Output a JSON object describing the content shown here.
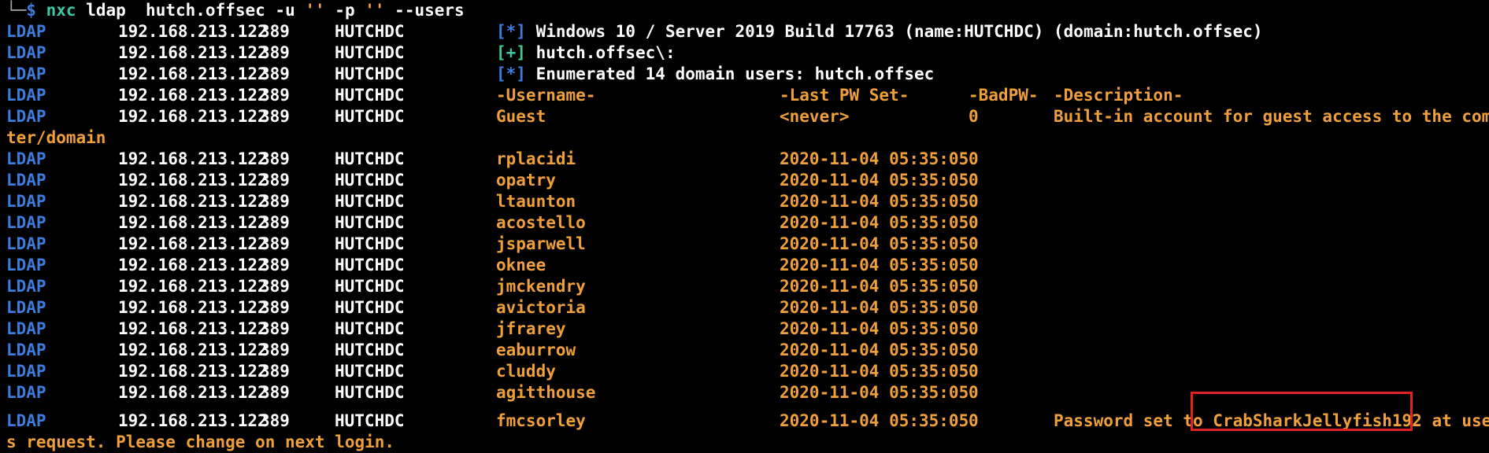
{
  "prompt": {
    "tree": "└─",
    "dollar": "$",
    "cmd": "nxc",
    "args_a": "ldap  hutch.offsec ",
    "flag_u": "-u",
    "val_u": " '' ",
    "flag_p": "-p",
    "val_p": " '' ",
    "flag_users": "--users"
  },
  "info_lines": [
    {
      "proto": "LDAP",
      "ip": "192.168.213.122",
      "port": "389",
      "host": "HUTCHDC",
      "tag": "[*]",
      "text": " Windows 10 / Server 2019 Build 17763 (name:HUTCHDC) (domain:hutch.offsec)"
    },
    {
      "proto": "LDAP",
      "ip": "192.168.213.122",
      "port": "389",
      "host": "HUTCHDC",
      "tag": "[+]",
      "text": " hutch.offsec\\:"
    },
    {
      "proto": "LDAP",
      "ip": "192.168.213.122",
      "port": "389",
      "host": "HUTCHDC",
      "tag": "[*]",
      "text": " Enumerated 14 domain users: hutch.offsec"
    }
  ],
  "header": {
    "proto": "LDAP",
    "ip": "192.168.213.122",
    "port": "389",
    "host": "HUTCHDC",
    "username": "-Username-",
    "pwset": "-Last PW Set-",
    "badpw": "-BadPW-",
    "description": "-Description-"
  },
  "guest": {
    "proto": "LDAP",
    "ip": "192.168.213.122",
    "port": "389",
    "host": "HUTCHDC",
    "username": "Guest",
    "pwset": "<never>",
    "badpw": "0",
    "description": "Built-in account for guest access to the compu",
    "wrap": "ter/domain"
  },
  "users": [
    {
      "proto": "LDAP",
      "ip": "192.168.213.122",
      "port": "389",
      "host": "HUTCHDC",
      "username": "rplacidi",
      "pwset": "2020-11-04 05:35:05",
      "badpw": "0"
    },
    {
      "proto": "LDAP",
      "ip": "192.168.213.122",
      "port": "389",
      "host": "HUTCHDC",
      "username": "opatry",
      "pwset": "2020-11-04 05:35:05",
      "badpw": "0"
    },
    {
      "proto": "LDAP",
      "ip": "192.168.213.122",
      "port": "389",
      "host": "HUTCHDC",
      "username": "ltaunton",
      "pwset": "2020-11-04 05:35:05",
      "badpw": "0"
    },
    {
      "proto": "LDAP",
      "ip": "192.168.213.122",
      "port": "389",
      "host": "HUTCHDC",
      "username": "acostello",
      "pwset": "2020-11-04 05:35:05",
      "badpw": "0"
    },
    {
      "proto": "LDAP",
      "ip": "192.168.213.122",
      "port": "389",
      "host": "HUTCHDC",
      "username": "jsparwell",
      "pwset": "2020-11-04 05:35:05",
      "badpw": "0"
    },
    {
      "proto": "LDAP",
      "ip": "192.168.213.122",
      "port": "389",
      "host": "HUTCHDC",
      "username": "oknee",
      "pwset": "2020-11-04 05:35:05",
      "badpw": "0"
    },
    {
      "proto": "LDAP",
      "ip": "192.168.213.122",
      "port": "389",
      "host": "HUTCHDC",
      "username": "jmckendry",
      "pwset": "2020-11-04 05:35:05",
      "badpw": "0"
    },
    {
      "proto": "LDAP",
      "ip": "192.168.213.122",
      "port": "389",
      "host": "HUTCHDC",
      "username": "avictoria",
      "pwset": "2020-11-04 05:35:05",
      "badpw": "0"
    },
    {
      "proto": "LDAP",
      "ip": "192.168.213.122",
      "port": "389",
      "host": "HUTCHDC",
      "username": "jfrarey",
      "pwset": "2020-11-04 05:35:05",
      "badpw": "0"
    },
    {
      "proto": "LDAP",
      "ip": "192.168.213.122",
      "port": "389",
      "host": "HUTCHDC",
      "username": "eaburrow",
      "pwset": "2020-11-04 05:35:05",
      "badpw": "0"
    },
    {
      "proto": "LDAP",
      "ip": "192.168.213.122",
      "port": "389",
      "host": "HUTCHDC",
      "username": "cluddy",
      "pwset": "2020-11-04 05:35:05",
      "badpw": "0"
    },
    {
      "proto": "LDAP",
      "ip": "192.168.213.122",
      "port": "389",
      "host": "HUTCHDC",
      "username": "agitthouse",
      "pwset": "2020-11-04 05:35:05",
      "badpw": "0"
    }
  ],
  "last_user": {
    "proto": "LDAP",
    "ip": "192.168.213.122",
    "port": "389",
    "host": "HUTCHDC",
    "username": "fmcsorley",
    "pwset": "2020-11-04 05:35:05",
    "badpw": "0",
    "desc_pre": "Password set to ",
    "desc_password": "CrabSharkJellyfish192",
    "desc_post": " at user'",
    "wrap": "s request. Please change on next login."
  },
  "colors": {
    "background": "#000000",
    "proto": "#3d7bdc",
    "status_info": "#3d7bdc",
    "status_success": "#3dc7a1",
    "value": "#f0a03a",
    "highlight_box": "#e0231f"
  }
}
